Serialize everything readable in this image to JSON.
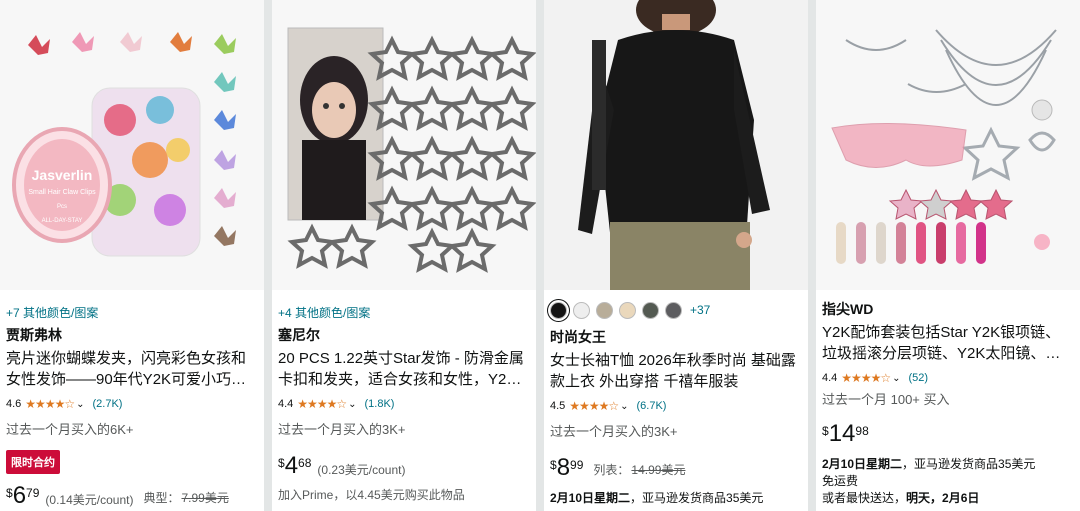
{
  "products": [
    {
      "image_alt": "butterfly hair claw clips jar",
      "image_label": {
        "line1": "Jasverlin",
        "line2": "Small Hair Claw Clips",
        "line3": "Pcs",
        "line4": "ALL-DAY-STAY"
      },
      "colors_link": "+7 其他颜色/图案",
      "brand": "贾斯弗林",
      "title": "亮片迷你蝴蝶发夹，闪亮彩色女孩和女性发饰——90年代Y2K可爱小巧…",
      "rating": "4.6",
      "rating_count": "(2.7K)",
      "bought": "过去一个月买入的6K+",
      "deal_badge": "限时合约",
      "price_symbol": "$",
      "price_whole": "6",
      "price_fraction": "79",
      "unit_price": "(0.14美元/count)",
      "typical_label": "典型：",
      "typical_price": "7.99美元"
    },
    {
      "image_alt": "star hair clips",
      "colors_link": "+4 其他颜色/图案",
      "brand": "塞尼尔",
      "title": "20 PCS 1.22英寸Star发饰 - 防滑金属卡扣和发夹，适合女孩和女性，Y2…",
      "rating": "4.4",
      "rating_count": "(1.8K)",
      "bought": "过去一个月买入的3K+",
      "price_symbol": "$",
      "price_whole": "4",
      "price_fraction": "68",
      "unit_price": "(0.23美元/count)",
      "prime_note": "加入Prime，以4.45美元购买此物品"
    },
    {
      "image_alt": "black long sleeve top",
      "swatches": [
        "#141414",
        "#eeeeee",
        "#b8ad99",
        "#ead8bc",
        "#545a52",
        "#5d5d60"
      ],
      "swatch_more": "+37",
      "brand": "时尚女王",
      "title": "女士长袖T恤 2026年秋季时尚 基础露款上衣 外出穿搭 千禧年服装",
      "rating": "4.5",
      "rating_count": "(6.7K)",
      "bought": "过去一个月买入的3K+",
      "price_symbol": "$",
      "price_whole": "8",
      "price_fraction": "99",
      "list_label": "列表：",
      "list_price": "14.99美元",
      "delivery_date": "2月10日星期二",
      "delivery_text": "，亚马逊发货商品35美元"
    },
    {
      "image_alt": "Y2K accessories set",
      "brand": "指尖WD",
      "title": "Y2K配饰套装包括Star Y2K银项链、垃圾摇滚分层项链、Y2K太阳镜、…",
      "rating": "4.4",
      "rating_count": "(52)",
      "bought": "过去一个月 100+ 买入",
      "price_symbol": "$",
      "price_whole": "14",
      "price_fraction": "98",
      "delivery_date": "2月10日星期二",
      "delivery_text": "，亚马逊发货商品35美元",
      "free_shipping": "免运费",
      "fastest_prefix": "或者最快送达，",
      "fastest_day": "明天，",
      "fastest_date": "2月6日"
    }
  ],
  "star_glyphs": "★★★★☆",
  "colors": {
    "link": "#007185",
    "star": "#de7921",
    "deal": "#cc0c39"
  }
}
